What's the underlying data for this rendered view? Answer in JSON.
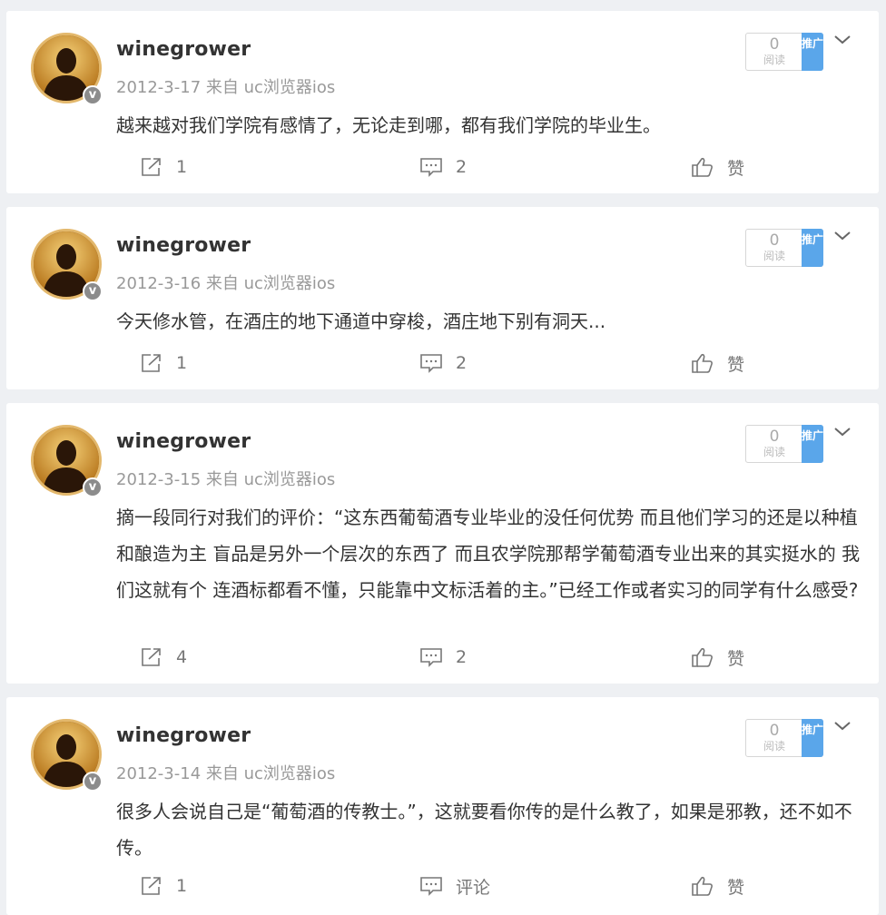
{
  "posts": [
    {
      "author": "winegrower",
      "meta": "2012-3-17 来自 uc浏览器ios",
      "content": "越来越对我们学院有感情了，无论走到哪，都有我们学院的毕业生。",
      "reads": "0",
      "reads_label": "阅读",
      "promo_label": "推广",
      "shares": "1",
      "comments": "2",
      "like_label": "赞"
    },
    {
      "author": "winegrower",
      "meta": "2012-3-16 来自 uc浏览器ios",
      "content": "今天修水管，在酒庄的地下通道中穿梭，酒庄地下别有洞天...",
      "reads": "0",
      "reads_label": "阅读",
      "promo_label": "推广",
      "shares": "1",
      "comments": "2",
      "like_label": "赞"
    },
    {
      "author": "winegrower",
      "meta": "2012-3-15 来自 uc浏览器ios",
      "content": "摘一段同行对我们的评价：“这东西葡萄酒专业毕业的没任何优势 而且他们学习的还是以种植和酿造为主 盲品是另外一个层次的东西了 而且农学院那帮学葡萄酒专业出来的其实挺水的 我们这就有个 连酒标都看不懂，只能靠中文标活着的主。”已经工作或者实习的同学有什么感受?",
      "reads": "0",
      "reads_label": "阅读",
      "promo_label": "推广",
      "shares": "4",
      "comments": "2",
      "like_label": "赞"
    },
    {
      "author": "winegrower",
      "meta": "2012-3-14 来自 uc浏览器ios",
      "content": "很多人会说自己是“葡萄酒的传教士。”，这就要看你传的是什么教了，如果是邪教，还不如不传。",
      "reads": "0",
      "reads_label": "阅读",
      "promo_label": "推广",
      "shares": "1",
      "comments": "评论",
      "like_label": "赞"
    }
  ],
  "badge_label": "v",
  "icons": {
    "share": "share-icon",
    "comment": "comment-icon",
    "like": "thumbs-up-icon",
    "chevron": "chevron-down-icon"
  },
  "colors": {
    "promo": "#5aa6ea",
    "meta_text": "#999999",
    "badge": "#8c8c8c"
  }
}
